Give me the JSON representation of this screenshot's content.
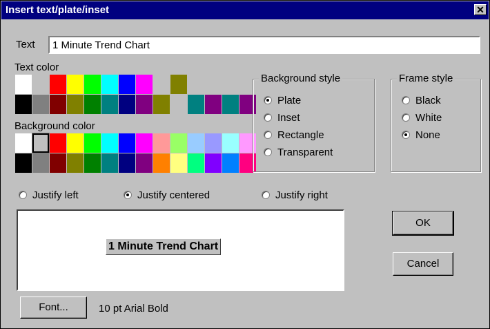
{
  "window": {
    "title": "Insert text/plate/inset",
    "close_glyph": "✕"
  },
  "text_field": {
    "label": "Text",
    "value": "1 Minute Trend Chart"
  },
  "text_color": {
    "label": "Text color",
    "swatches": [
      "#ffffff",
      "#c0c0c0",
      "#ff0000",
      "#ffff00",
      "#00ff00",
      "#00ffff",
      "#0000ff",
      "#ff00ff",
      "#c0c0c0",
      "#808000",
      "#c0c0c0",
      "#c0c0c0",
      "#c0c0c0",
      "#c0c0c0",
      "#000000",
      "#808080",
      "#800000",
      "#808000",
      "#008000",
      "#008080",
      "#000080",
      "#800080",
      "#808000",
      "#c0c0c0",
      "#008080",
      "#800080",
      "#008080",
      "#800080"
    ]
  },
  "background_color": {
    "label": "Background color",
    "selected_index": 1,
    "swatches": [
      "#ffffff",
      "#c0c0c0",
      "#ff0000",
      "#ffff00",
      "#00ff00",
      "#00ffff",
      "#0000ff",
      "#ff00ff",
      "#ff9999",
      "#99ff66",
      "#99ccff",
      "#9999ff",
      "#99ffff",
      "#ff99ff",
      "#000000",
      "#808080",
      "#800000",
      "#808000",
      "#008000",
      "#008080",
      "#000080",
      "#800080",
      "#ff8000",
      "#ffff80",
      "#00ff80",
      "#8000ff",
      "#0080ff",
      "#ff0080"
    ]
  },
  "background_style": {
    "label": "Background style",
    "options": [
      {
        "label": "Plate",
        "checked": true
      },
      {
        "label": "Inset",
        "checked": false
      },
      {
        "label": "Rectangle",
        "checked": false
      },
      {
        "label": "Transparent",
        "checked": false
      }
    ]
  },
  "frame_style": {
    "label": "Frame style",
    "options": [
      {
        "label": "Black",
        "checked": false
      },
      {
        "label": "White",
        "checked": false
      },
      {
        "label": "None",
        "checked": true
      }
    ]
  },
  "justify": {
    "options": [
      {
        "label": "Justify left",
        "checked": false
      },
      {
        "label": "Justify centered",
        "checked": true
      },
      {
        "label": "Justify right",
        "checked": false
      }
    ]
  },
  "preview": {
    "text": "1 Minute Trend Chart"
  },
  "buttons": {
    "ok": "OK",
    "cancel": "Cancel",
    "font": "Font..."
  },
  "font_description": "10 pt Arial Bold"
}
